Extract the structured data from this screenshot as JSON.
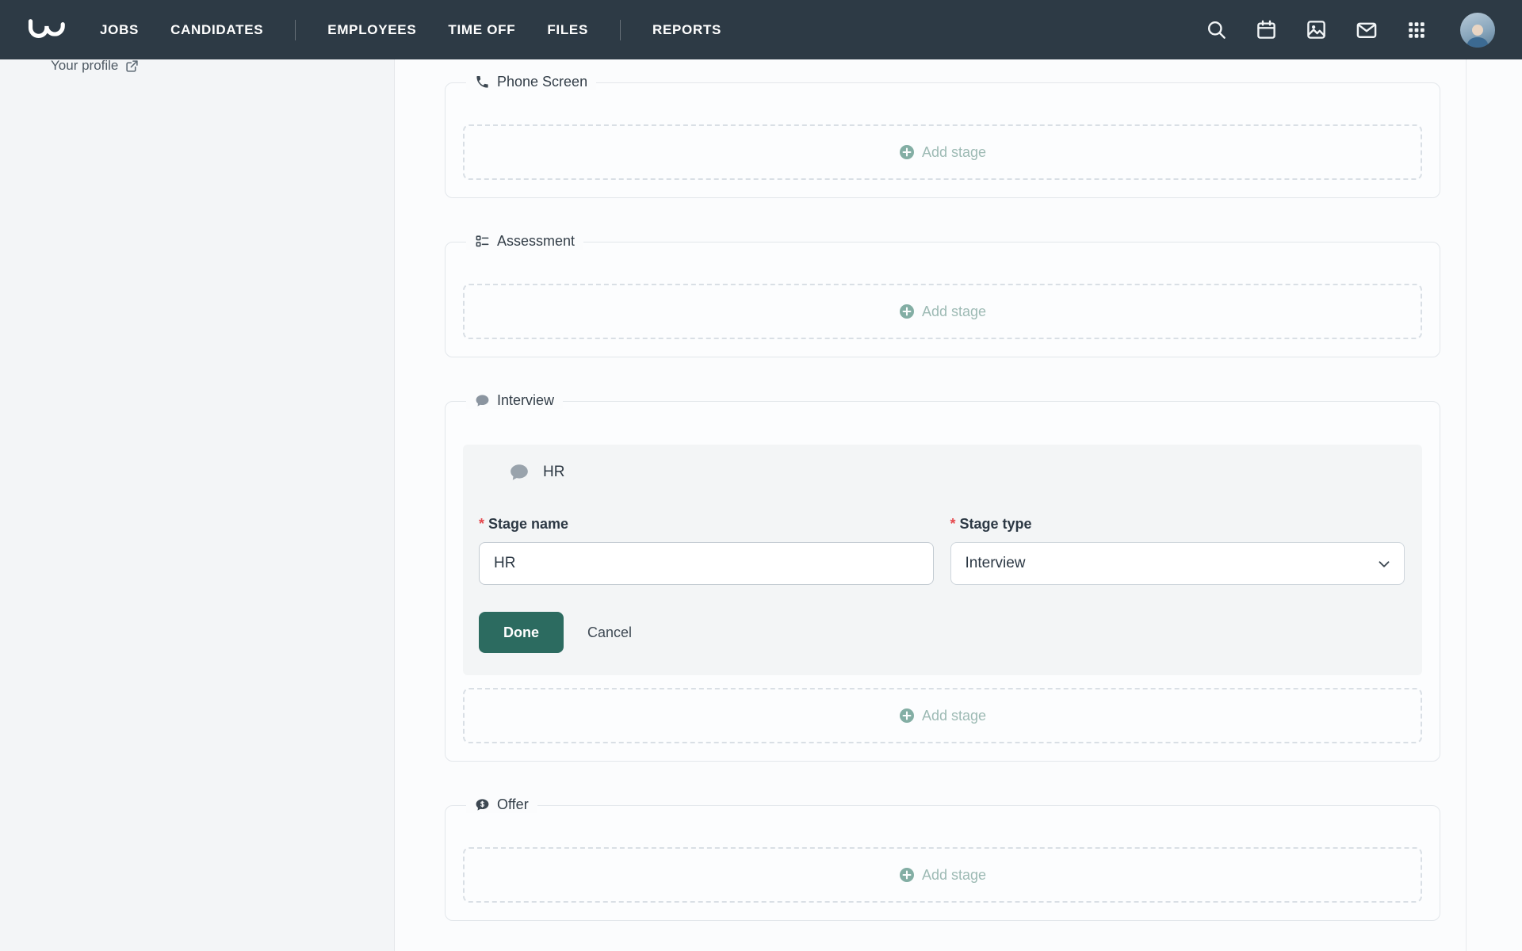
{
  "nav": {
    "items": [
      "JOBS",
      "CANDIDATES",
      "EMPLOYEES",
      "TIME OFF",
      "FILES",
      "REPORTS"
    ]
  },
  "sidebar": {
    "profile_link": "Your profile"
  },
  "pipeline": {
    "sections": [
      {
        "label": "Phone Screen",
        "icon": "phone-icon",
        "add_stage": "Add stage"
      },
      {
        "label": "Assessment",
        "icon": "checklist-icon",
        "add_stage": "Add stage"
      },
      {
        "label": "Interview",
        "icon": "chat-bubble-icon",
        "add_stage": "Add stage",
        "editor": {
          "stage_title": "HR",
          "name_label": "Stage name",
          "name_value": "HR",
          "type_label": "Stage type",
          "type_value": "Interview",
          "done": "Done",
          "cancel": "Cancel"
        }
      },
      {
        "label": "Offer",
        "icon": "offer-bubble-icon",
        "add_stage": "Add stage"
      }
    ]
  },
  "colors": {
    "nav_bg": "#2d3a45",
    "accent_teal": "#2c6b60",
    "muted_teal": "#9dbab4",
    "danger_red": "#e5484d"
  }
}
